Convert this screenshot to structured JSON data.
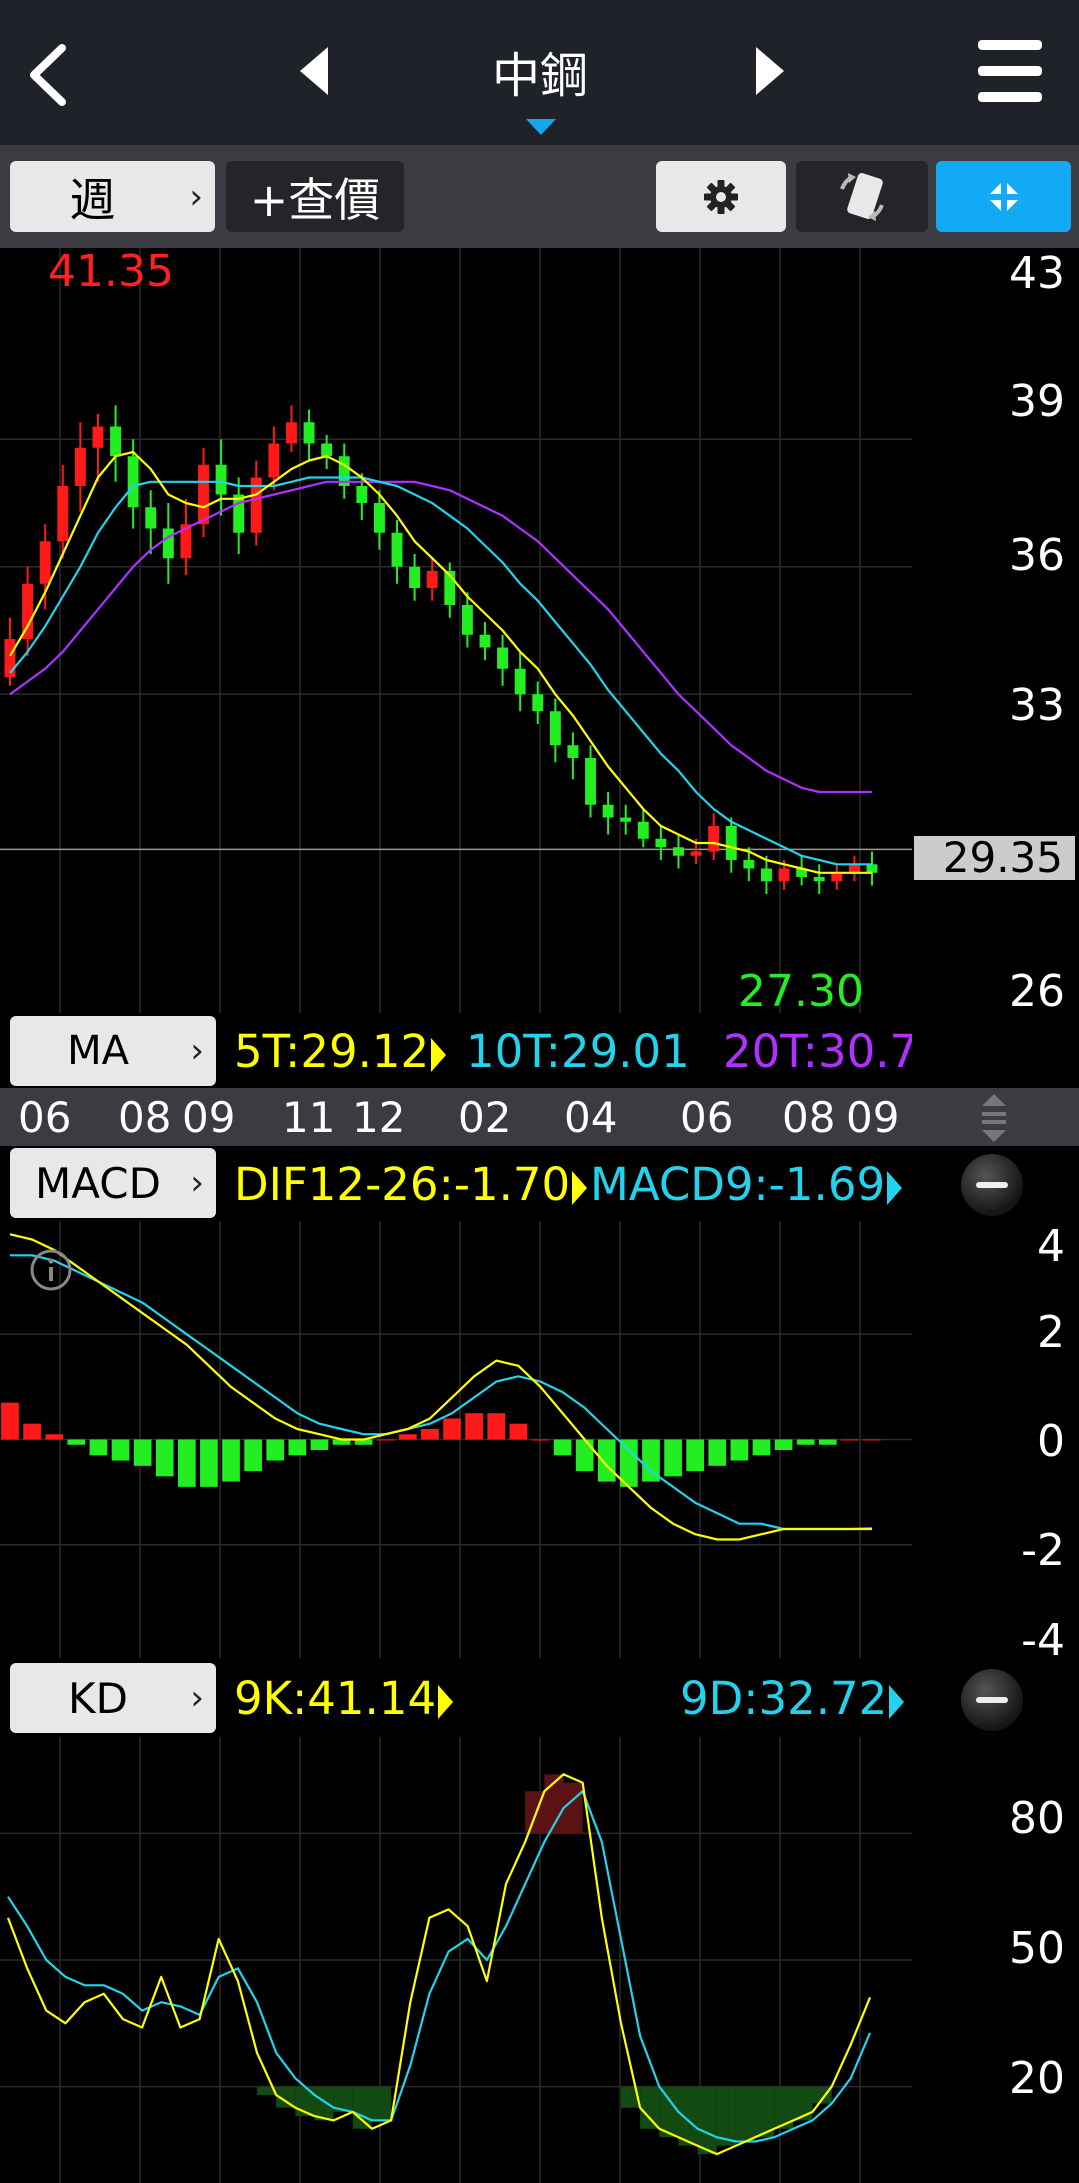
{
  "header": {
    "title": "中鋼",
    "back_icon": "chevron-left-icon",
    "prev_icon": "triangle-left-icon",
    "next_icon": "triangle-right-icon",
    "menu_icon": "hamburger-menu-icon"
  },
  "toolbar": {
    "period_label": "週",
    "quote_label": "+查價",
    "settings_icon": "gear-icon",
    "rotate_icon": "rotate-screen-icon",
    "fullscreen_icon": "collapse-arrows-icon",
    "accent_color": "#12a9f5"
  },
  "price_panel": {
    "high_label": "41.35",
    "low_label": "27.30",
    "current_price": "29.35",
    "y_axis_ticks": [
      "43",
      "39",
      "36",
      "33",
      "26"
    ],
    "ma_selector": "MA",
    "ma5_label": "5T:29.12",
    "ma10_label": "10T:29.01",
    "ma20_label": "20T:30.7"
  },
  "date_axis": [
    "06",
    "08",
    "09",
    "11",
    "12",
    "02",
    "04",
    "06",
    "08",
    "09"
  ],
  "macd_panel": {
    "selector": "MACD",
    "dif_label": "DIF12-26:-1.70",
    "macd_label": "MACD9:-1.69",
    "y_axis_ticks": [
      "4",
      "2",
      "0",
      "-2",
      "-4"
    ]
  },
  "kd_panel": {
    "selector": "KD",
    "k_label": "9K:41.14",
    "d_label": "9D:32.72",
    "y_axis_ticks": [
      "80",
      "50",
      "20"
    ]
  },
  "colors": {
    "up": "#ff1a1a",
    "down": "#22ee22",
    "ma5": "#ffff00",
    "ma10": "#22d3ee",
    "ma20": "#b030ff"
  },
  "chart_data": [
    {
      "type": "candlestick",
      "ylim": [
        25.5,
        43.5
      ],
      "candles": [
        [
          33.4,
          34.3,
          34.8,
          33.2
        ],
        [
          34.3,
          35.6,
          36.0,
          33.9
        ],
        [
          35.6,
          36.6,
          37.0,
          35.0
        ],
        [
          36.6,
          37.9,
          38.4,
          36.2
        ],
        [
          37.9,
          38.8,
          39.4,
          37.3
        ],
        [
          38.8,
          39.3,
          39.6,
          38.0
        ],
        [
          39.3,
          38.6,
          39.8,
          38.0
        ],
        [
          38.6,
          37.4,
          39.0,
          36.9
        ],
        [
          37.4,
          36.9,
          37.8,
          36.3
        ],
        [
          36.9,
          36.2,
          37.5,
          35.6
        ],
        [
          36.2,
          37.0,
          37.6,
          35.8
        ],
        [
          37.0,
          38.4,
          38.8,
          36.7
        ],
        [
          38.4,
          37.7,
          39.0,
          37.2
        ],
        [
          37.7,
          36.8,
          38.1,
          36.3
        ],
        [
          36.8,
          38.1,
          38.5,
          36.5
        ],
        [
          38.1,
          38.9,
          39.3,
          37.8
        ],
        [
          38.9,
          39.4,
          39.8,
          38.7
        ],
        [
          39.4,
          38.9,
          39.7,
          38.5
        ],
        [
          38.9,
          38.6,
          39.1,
          38.3
        ],
        [
          38.6,
          37.9,
          38.9,
          37.6
        ],
        [
          37.9,
          37.5,
          38.2,
          37.1
        ],
        [
          37.5,
          36.8,
          37.8,
          36.4
        ],
        [
          36.8,
          36.0,
          37.1,
          35.6
        ],
        [
          36.0,
          35.5,
          36.3,
          35.2
        ],
        [
          35.5,
          35.9,
          36.2,
          35.2
        ],
        [
          35.9,
          35.1,
          36.1,
          34.8
        ],
        [
          35.1,
          34.4,
          35.4,
          34.1
        ],
        [
          34.4,
          34.1,
          34.7,
          33.8
        ],
        [
          34.1,
          33.6,
          34.4,
          33.2
        ],
        [
          33.6,
          33.0,
          34.0,
          32.6
        ],
        [
          33.0,
          32.6,
          33.3,
          32.3
        ],
        [
          32.6,
          31.8,
          32.9,
          31.4
        ],
        [
          31.8,
          31.5,
          32.1,
          31.0
        ],
        [
          31.5,
          30.4,
          31.8,
          30.1
        ],
        [
          30.4,
          30.1,
          30.7,
          29.7
        ],
        [
          30.1,
          30.0,
          30.4,
          29.7
        ],
        [
          30.0,
          29.6,
          30.3,
          29.4
        ],
        [
          29.6,
          29.4,
          29.9,
          29.1
        ],
        [
          29.4,
          29.2,
          29.7,
          28.9
        ],
        [
          29.2,
          29.3,
          29.6,
          29.0
        ],
        [
          29.3,
          29.9,
          30.2,
          29.1
        ],
        [
          29.9,
          29.1,
          30.1,
          28.8
        ],
        [
          29.1,
          28.9,
          29.4,
          28.6
        ],
        [
          28.9,
          28.6,
          29.2,
          28.3
        ],
        [
          28.6,
          28.9,
          29.1,
          28.4
        ],
        [
          28.9,
          28.7,
          29.2,
          28.5
        ],
        [
          28.7,
          28.6,
          29.0,
          28.3
        ],
        [
          28.6,
          28.8,
          29.0,
          28.4
        ],
        [
          28.8,
          29.0,
          29.2,
          28.6
        ],
        [
          29.0,
          28.8,
          29.3,
          28.5
        ]
      ],
      "ma5": [
        33.9,
        34.6,
        35.4,
        36.3,
        37.2,
        38.1,
        38.6,
        38.7,
        38.3,
        37.7,
        37.5,
        37.4,
        37.6,
        37.6,
        37.7,
        38.0,
        38.3,
        38.5,
        38.6,
        38.4,
        38.1,
        37.7,
        37.2,
        36.6,
        36.2,
        35.8,
        35.3,
        34.9,
        34.5,
        34.0,
        33.6,
        33.0,
        32.5,
        31.9,
        31.3,
        30.8,
        30.3,
        29.9,
        29.7,
        29.5,
        29.5,
        29.4,
        29.3,
        29.1,
        29.0,
        28.9,
        28.8,
        28.8,
        28.8,
        28.8
      ],
      "ma10": [
        33.5,
        34.0,
        34.6,
        35.3,
        36.0,
        36.8,
        37.4,
        37.9,
        38.0,
        38.0,
        38.0,
        38.0,
        38.0,
        37.9,
        37.9,
        37.9,
        38.0,
        38.1,
        38.1,
        38.1,
        38.1,
        38.0,
        37.9,
        37.7,
        37.5,
        37.2,
        36.9,
        36.5,
        36.1,
        35.6,
        35.2,
        34.7,
        34.2,
        33.7,
        33.1,
        32.6,
        32.1,
        31.6,
        31.2,
        30.7,
        30.3,
        30.0,
        29.8,
        29.6,
        29.4,
        29.2,
        29.1,
        29.0,
        29.0,
        29.0
      ],
      "ma20": [
        33.0,
        33.3,
        33.6,
        34.0,
        34.5,
        35.0,
        35.5,
        36.0,
        36.4,
        36.7,
        36.9,
        37.1,
        37.3,
        37.5,
        37.6,
        37.7,
        37.8,
        37.9,
        38.0,
        38.0,
        38.0,
        38.0,
        38.0,
        38.0,
        37.9,
        37.8,
        37.6,
        37.4,
        37.2,
        36.9,
        36.6,
        36.2,
        35.8,
        35.4,
        35.0,
        34.5,
        34.0,
        33.5,
        33.0,
        32.6,
        32.2,
        31.8,
        31.5,
        31.2,
        31.0,
        30.8,
        30.7,
        30.7,
        30.7,
        30.7
      ]
    },
    {
      "type": "bar+line",
      "title": "MACD",
      "ylim": [
        -4,
        4
      ],
      "series": [
        {
          "name": "DIF12-26",
          "values": [
            3.9,
            3.8,
            3.6,
            3.3,
            3.0,
            2.7,
            2.4,
            2.1,
            1.8,
            1.4,
            1.0,
            0.7,
            0.4,
            0.2,
            0.1,
            0.0,
            0.0,
            0.1,
            0.2,
            0.4,
            0.8,
            1.2,
            1.5,
            1.4,
            1.0,
            0.5,
            0.0,
            -0.5,
            -0.9,
            -1.3,
            -1.6,
            -1.8,
            -1.9,
            -1.9,
            -1.8,
            -1.7,
            -1.7,
            -1.7,
            -1.7,
            -1.7
          ]
        },
        {
          "name": "MACD9",
          "values": [
            3.5,
            3.5,
            3.4,
            3.2,
            3.0,
            2.8,
            2.6,
            2.3,
            2.0,
            1.7,
            1.4,
            1.1,
            0.8,
            0.5,
            0.3,
            0.2,
            0.1,
            0.1,
            0.2,
            0.3,
            0.5,
            0.8,
            1.1,
            1.2,
            1.1,
            0.9,
            0.6,
            0.2,
            -0.2,
            -0.6,
            -0.9,
            -1.2,
            -1.4,
            -1.6,
            -1.6,
            -1.7,
            -1.7,
            -1.7,
            -1.7,
            -1.69
          ]
        },
        {
          "name": "OSC",
          "values": [
            0.7,
            0.3,
            0.1,
            -0.1,
            -0.3,
            -0.4,
            -0.5,
            -0.7,
            -0.9,
            -0.9,
            -0.8,
            -0.6,
            -0.4,
            -0.3,
            -0.2,
            -0.1,
            -0.1,
            0.0,
            0.1,
            0.2,
            0.4,
            0.5,
            0.5,
            0.3,
            0.0,
            -0.3,
            -0.6,
            -0.8,
            -0.9,
            -0.8,
            -0.7,
            -0.6,
            -0.5,
            -0.4,
            -0.3,
            -0.2,
            -0.1,
            -0.1,
            0.0,
            0.0
          ]
        }
      ]
    },
    {
      "type": "line",
      "title": "KD",
      "ylim": [
        0,
        100
      ],
      "series": [
        {
          "name": "9K",
          "values": [
            60,
            48,
            38,
            35,
            40,
            42,
            36,
            34,
            46,
            34,
            36,
            55,
            45,
            28,
            18,
            15,
            13,
            12,
            14,
            10,
            12,
            40,
            60,
            62,
            58,
            45,
            68,
            78,
            90,
            94,
            92,
            60,
            35,
            15,
            10,
            8,
            6,
            4,
            6,
            8,
            10,
            12,
            14,
            20,
            30,
            41.14
          ]
        },
        {
          "name": "9D",
          "values": [
            65,
            58,
            50,
            46,
            44,
            44,
            42,
            38,
            40,
            39,
            37,
            46,
            48,
            40,
            28,
            22,
            18,
            15,
            14,
            12,
            12,
            25,
            42,
            52,
            55,
            50,
            58,
            68,
            78,
            86,
            90,
            78,
            55,
            32,
            20,
            14,
            10,
            8,
            7,
            7,
            8,
            10,
            12,
            16,
            22,
            32.72
          ]
        }
      ]
    }
  ]
}
